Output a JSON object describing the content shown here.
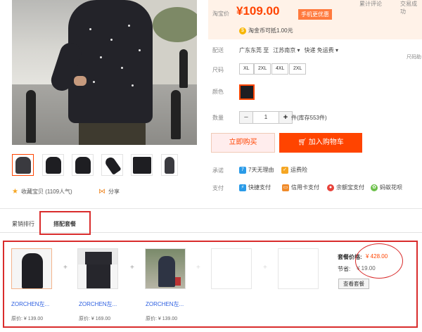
{
  "top_links": [
    "累计评论",
    "交易成功"
  ],
  "price": {
    "label": "淘宝价",
    "value": "¥109.00",
    "promo": "手机更优惠"
  },
  "coins": {
    "text": "淘金币可抵1.00元"
  },
  "shipping": {
    "label": "配送",
    "from": "广东东莞 至",
    "to": "江苏南京",
    "method": "快递 免运费"
  },
  "side_note": "尺码助",
  "size": {
    "label": "尺码",
    "options": [
      "XL",
      "2XL",
      "4XL",
      "2XL"
    ]
  },
  "color": {
    "label": "颜色"
  },
  "quantity": {
    "label": "数量",
    "value": "1",
    "minus": "−",
    "plus": "+",
    "stock": "件(库存553件)"
  },
  "buttons": {
    "buy_now": "立即购买",
    "add_cart": "加入购物车"
  },
  "promise": {
    "label": "承诺",
    "items": [
      "7天无理由",
      "运费险"
    ]
  },
  "payment": {
    "label": "支付",
    "items": [
      "快捷支付",
      "信用卡支付",
      "余额宝支付",
      "蚂蚁花呗"
    ]
  },
  "favorite": "收藏宝贝 (1109人气)",
  "share": "分享",
  "tabs": [
    "累销排行",
    "搭配套餐"
  ],
  "package": {
    "items": [
      {
        "name": "ZORCHEN左...",
        "orig": "原价: ¥ 139.00"
      },
      {
        "name": "ZORCHEN左...",
        "orig": "原价: ¥ 169.00"
      },
      {
        "name": "ZORCHEN左...",
        "orig": "原价: ¥ 139.00"
      }
    ],
    "price_label": "套餐价格:",
    "price_value": "¥ 428.00",
    "save_label": "节省:",
    "save_value": "¥ 19.00",
    "view_button": "查看套餐"
  },
  "colors": {
    "accent": "#ff4400",
    "highlight": "#d92c2c",
    "link": "#2b5ee0"
  }
}
